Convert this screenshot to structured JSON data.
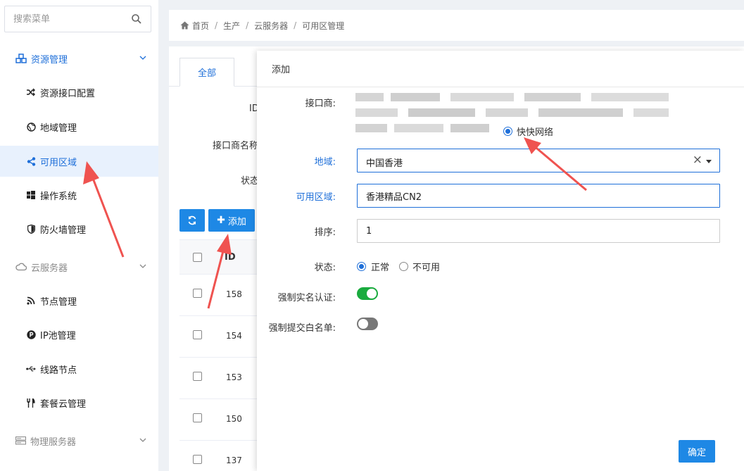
{
  "colors": {
    "accent": "#1e6fd9",
    "primary_button": "#1e88e5",
    "switch_on": "#1aab3e",
    "arrow": "#ef5350"
  },
  "sidebar": {
    "search_placeholder": "搜索菜单",
    "groups": [
      {
        "label": "资源管理",
        "icon": "cubes-icon",
        "expanded": true
      },
      {
        "label": "云服务器",
        "icon": "cloud-icon",
        "expanded": false
      },
      {
        "label": "物理服务器",
        "icon": "server-icon",
        "expanded": false
      }
    ],
    "items": [
      {
        "label": "资源接口配置",
        "icon": "shuffle-icon"
      },
      {
        "label": "地域管理",
        "icon": "globe-icon"
      },
      {
        "label": "可用区域",
        "icon": "share-icon",
        "selected": true
      },
      {
        "label": "操作系统",
        "icon": "windows-icon"
      },
      {
        "label": "防火墙管理",
        "icon": "shield-icon"
      },
      {
        "label": "节点管理",
        "icon": "rss-icon"
      },
      {
        "label": "IP池管理",
        "icon": "parking-icon"
      },
      {
        "label": "线路节点",
        "icon": "usb-icon"
      },
      {
        "label": "套餐云管理",
        "icon": "cutlery-icon"
      }
    ]
  },
  "breadcrumb": [
    "首页",
    "生产",
    "云服务器",
    "可用区管理"
  ],
  "main": {
    "tab_all": "全部",
    "filters": {
      "id": "ID",
      "provider_name": "接口商名称",
      "status": "状态"
    },
    "add_button": "添加",
    "table": {
      "header_id": "ID",
      "rows": [
        {
          "id": "158"
        },
        {
          "id": "154"
        },
        {
          "id": "153"
        },
        {
          "id": "150"
        },
        {
          "id": "137"
        }
      ]
    }
  },
  "modal": {
    "title": "添加",
    "fields": {
      "provider_label": "接口商:",
      "provider_option": "快快网络",
      "region_label": "地域:",
      "region_value": "中国香港",
      "zone_label": "可用区域:",
      "zone_value": "香港精品CN2",
      "sort_label": "排序:",
      "sort_value": "1",
      "status_label": "状态:",
      "status_options": [
        "正常",
        "不可用"
      ],
      "status_selected": "正常",
      "realname_label": "强制实名认证:",
      "realname_on": true,
      "whitelist_label": "强制提交白名单:",
      "whitelist_on": false
    },
    "confirm_button": "确定"
  }
}
